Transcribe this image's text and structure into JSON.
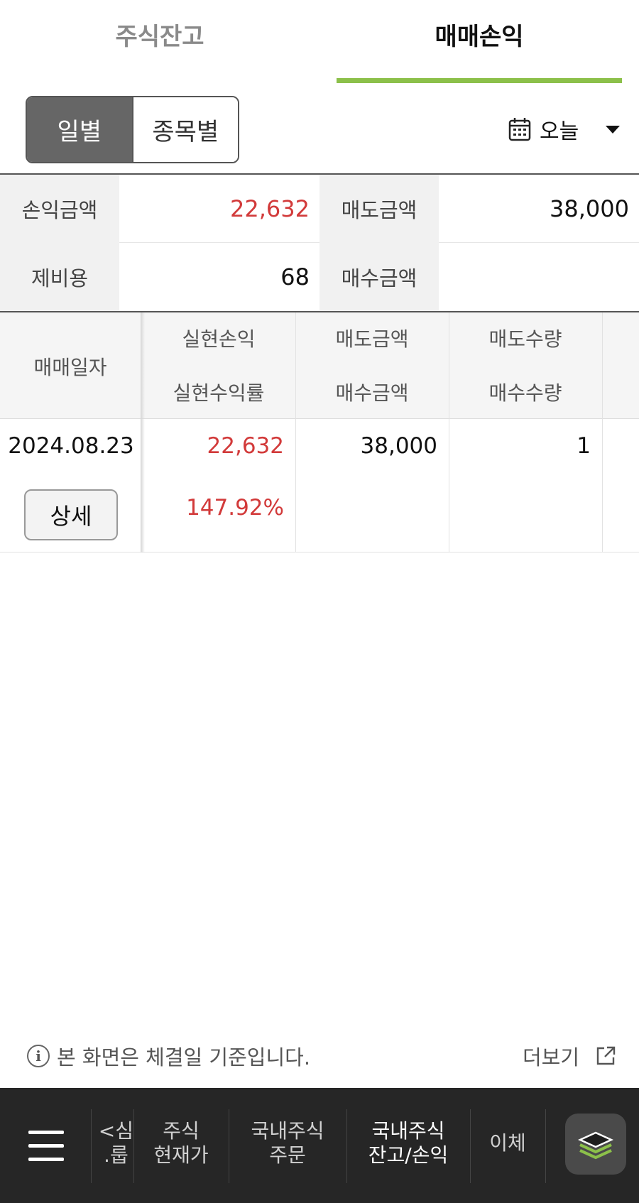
{
  "tabs": [
    "주식잔고",
    "매매손익"
  ],
  "active_tab": "매매손익",
  "colors": {
    "accent": "#8cc04a",
    "profit": "#d23a3a"
  },
  "segment": {
    "daily": "일별",
    "by_stock": "종목별",
    "selected": "일별"
  },
  "period": {
    "icon": "calendar-icon",
    "label": "오늘"
  },
  "summary": {
    "pnl_label": "손익금액",
    "pnl_value": "22,632",
    "sell_label": "매도금액",
    "sell_value": "38,000",
    "fee_label": "제비용",
    "fee_value": "68",
    "buy_label": "매수금액",
    "buy_value": ""
  },
  "grid": {
    "headers": {
      "date": "매매일자",
      "realized_pnl": "실현손익",
      "realized_rate": "실현수익률",
      "sell_amount": "매도금액",
      "buy_amount": "매수금액",
      "sell_qty": "매도수량",
      "buy_qty": "매수수량"
    },
    "rows": [
      {
        "date": "2024.08.23",
        "detail": "상세",
        "realized_pnl": "22,632",
        "realized_rate": "147.92%",
        "sell_amount": "38,000",
        "buy_amount": "",
        "sell_qty": "1",
        "buy_qty": ""
      }
    ]
  },
  "notice": {
    "icon": "info-icon",
    "text": "본 화면은 체결일 기준입니다.",
    "more": "더보기",
    "more_icon": "external-link-icon"
  },
  "bottom_nav": {
    "menu_icon": "hamburger-menu-icon",
    "items": [
      "관심\n그룹",
      "주식\n현재가",
      "국내주식\n주문",
      "국내주식\n잔고/손익",
      "이체"
    ],
    "items_visible_text": [
      "<심\n.룹",
      "주식\n현재가",
      "국내주식\n주문",
      "국내주식\n잔고/손익",
      "이체"
    ],
    "active": "국내주식\n잔고/손익",
    "layers_icon": "layers-icon"
  }
}
